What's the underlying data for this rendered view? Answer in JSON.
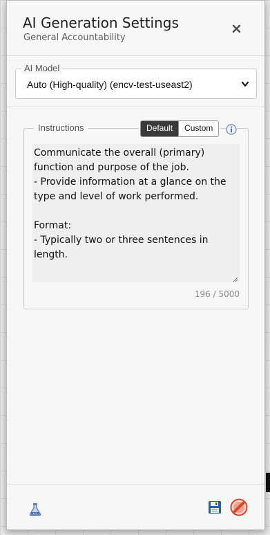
{
  "header": {
    "title": "AI Generation Settings",
    "subtitle": "General Accountability",
    "close_icon": "close-icon"
  },
  "model": {
    "legend": "AI Model",
    "selected": "Auto (High-quality) (encv-test-useast2)",
    "dropdown_icon": "chevron-down-icon"
  },
  "instructions": {
    "legend": "Instructions",
    "modes": [
      "Default",
      "Custom"
    ],
    "active_mode": "Default",
    "info_icon": "info-icon",
    "text": "Communicate the overall (primary)\nfunction and purpose of the job.\n- Provide information at a glance on the\ntype and level of work performed.\n\nFormat:\n- Typically two or three sentences in\nlength.",
    "counter": "196 / 5000"
  },
  "footer": {
    "left_icon": "flask-icon",
    "save_icon": "save-icon",
    "cancel_icon": "cancel-icon"
  },
  "colors": {
    "toggle_active_bg": "#3a3a3a",
    "cancel_red": "#d9472b",
    "save_blue": "#2f5f9e",
    "flask_blue": "#4a6fb5"
  }
}
